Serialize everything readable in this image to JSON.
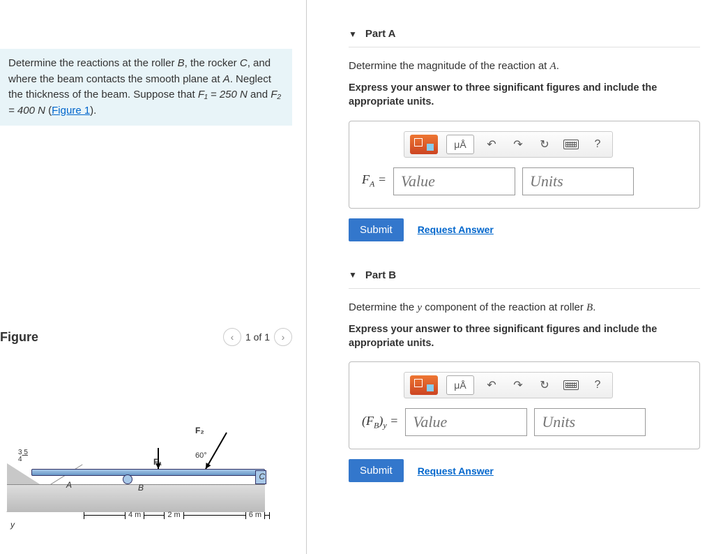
{
  "problem": {
    "text_prefix": "Determine the reactions at the roller ",
    "varB": "B",
    "text_mid1": ", the rocker ",
    "varC": "C",
    "text_mid2": ", and where the beam contacts the smooth plane at ",
    "varA": "A",
    "text_mid3": ". Neglect the thickness of the beam. Suppose that ",
    "f1_label": "F₁ = 250 N",
    "and": " and ",
    "f2_label": "F₂ = 400 N",
    "figlink": "Figure 1"
  },
  "figure": {
    "title": "Figure",
    "pager": "1 of 1",
    "labels": {
      "F1": "F₁",
      "F2": "F₂",
      "angle": "60°",
      "A": "A",
      "B": "B",
      "C": "C",
      "triTop": "3",
      "triBot": "4",
      "triHyp": "5",
      "d1": "4 m",
      "d2": "2 m",
      "d3": "6 m",
      "y": "y"
    }
  },
  "parts": [
    {
      "title": "Part A",
      "prompt_pre": "Determine the magnitude of the reaction at ",
      "prompt_var": "A",
      "prompt_post": ".",
      "instruction": "Express your answer to three significant figures and include the appropriate units.",
      "lhs_html": "F<sub>A</sub> =",
      "value_ph": "Value",
      "units_ph": "Units",
      "submit": "Submit",
      "request": "Request Answer",
      "ua": "μÅ"
    },
    {
      "title": "Part B",
      "prompt_pre": "Determine the ",
      "prompt_var": "y",
      "prompt_mid": " component of the reaction at roller ",
      "prompt_var2": "B",
      "prompt_post": ".",
      "instruction": "Express your answer to three significant figures and include the appropriate units.",
      "lhs_html": "(F<sub>B</sub>)<sub>y</sub> =",
      "value_ph": "Value",
      "units_ph": "Units",
      "submit": "Submit",
      "request": "Request Answer",
      "ua": "μÅ"
    }
  ]
}
